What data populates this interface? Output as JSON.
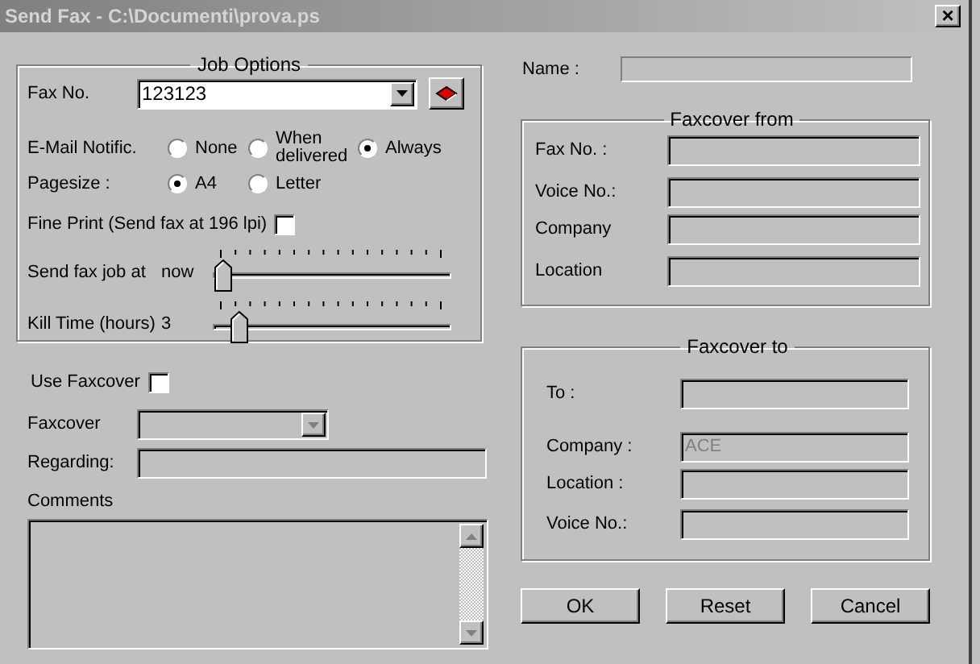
{
  "window": {
    "title": "Send Fax - C:\\Documenti\\prova.ps",
    "close": "×"
  },
  "job_options": {
    "title": "Job Options",
    "fax_no": {
      "label": "Fax No.",
      "value": "123123"
    },
    "email_notification": {
      "label": "E-Mail Notific.",
      "options": [
        {
          "label": "None",
          "selected": false
        },
        {
          "label": "When delivered",
          "selected": false
        },
        {
          "label": "Always",
          "selected": true
        }
      ]
    },
    "pagesize": {
      "label": "Pagesize :",
      "options": [
        {
          "label": "A4",
          "selected": true
        },
        {
          "label": "Letter",
          "selected": false
        }
      ]
    },
    "fine_print": {
      "label": "Fine Print (Send fax at 196 lpi)",
      "checked": false
    },
    "sliders": [
      {
        "label": "Send fax job at",
        "reading": "now",
        "level": 0
      },
      {
        "label": "Kill Time (hours)",
        "reading": "3",
        "level": 0.07
      }
    ]
  },
  "use_faxcover": {
    "label": "Use Faxcover",
    "checked": false
  },
  "faxcover": {
    "label": "Faxcover"
  },
  "regarding": {
    "label": "Regarding:"
  },
  "comments": {
    "label": "Comments"
  },
  "name": {
    "label": "Name :"
  },
  "faxcover_from": {
    "title": "Faxcover  from",
    "fields": [
      {
        "label": "Fax No. :"
      },
      {
        "label": "Voice No.:"
      },
      {
        "label": "Company"
      },
      {
        "label": "Location"
      }
    ]
  },
  "faxcover_to": {
    "title": "Faxcover to",
    "fields": [
      {
        "label": "To :"
      },
      {
        "label": "Company :",
        "value": "ACE"
      },
      {
        "label": "Location :"
      },
      {
        "label": "Voice No.:"
      }
    ]
  },
  "buttons": [
    "OK",
    "Reset",
    "Cancel"
  ]
}
